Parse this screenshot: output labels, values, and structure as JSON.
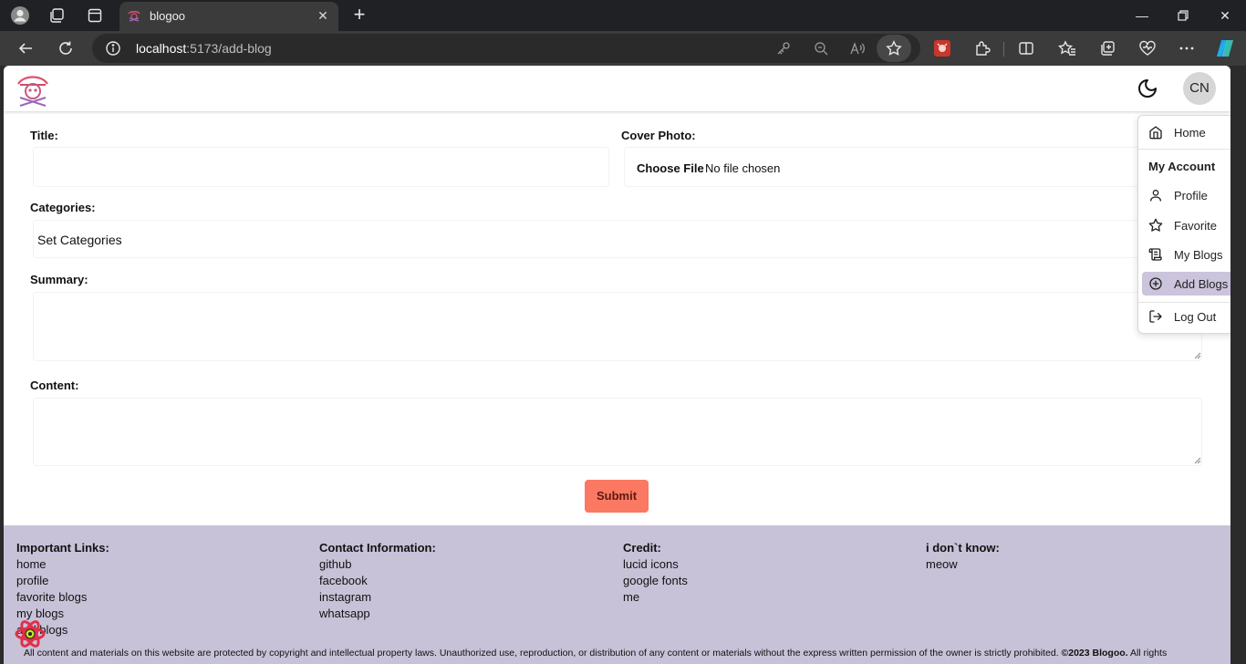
{
  "browser": {
    "tab_title": "blogoo",
    "url_host": "localhost",
    "url_path": ":5173/add-blog"
  },
  "header": {
    "avatar_initials": "CN"
  },
  "form": {
    "title_label": "Title:",
    "cover_label": "Cover Photo:",
    "file_button": "Choose File",
    "file_status": "No file chosen",
    "categories_label": "Categories:",
    "categories_placeholder": "Set Categories",
    "summary_label": "Summary:",
    "content_label": "Content:",
    "submit_label": "Submit"
  },
  "menu": {
    "home": "Home",
    "heading": "My Account",
    "items": [
      "Profile",
      "Favorite",
      "My Blogs",
      "Add Blogs"
    ],
    "logout": "Log Out"
  },
  "footer": {
    "columns": [
      {
        "title": "Important Links:",
        "links": [
          "home",
          "profile",
          "favorite blogs",
          "my blogs",
          "add blogs"
        ]
      },
      {
        "title": "Contact Information:",
        "links": [
          "github",
          "facebook",
          "instagram",
          "whatsapp"
        ]
      },
      {
        "title": "Credit:",
        "links": [
          "lucid icons",
          "google fonts",
          "me"
        ]
      },
      {
        "title": "i don`t know:",
        "links": [
          "meow"
        ]
      }
    ],
    "copyright_text": "All content and materials on this website are protected by copyright and intellectual property laws. Unauthorized use, reproduction, or distribution of any content or materials without the express written permission of the owner is strictly prohibited.",
    "copyright_brand": "©2023 Blogoo.",
    "copyright_tail": "All rights"
  },
  "colors": {
    "submit": "#fb7862",
    "footer_bg": "#c8c2d8",
    "menu_active": "#cbc4dc"
  }
}
